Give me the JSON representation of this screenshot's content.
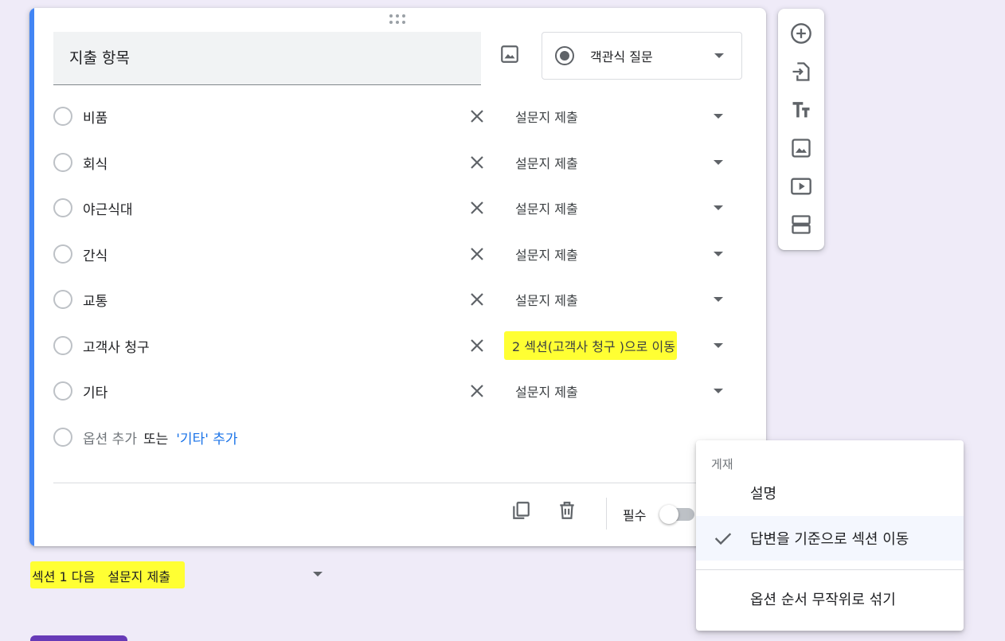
{
  "question": {
    "title": "지출 항목",
    "type_label": "객관식 질문",
    "options": [
      {
        "label": "비품",
        "goto": "설문지 제출",
        "highlight": false
      },
      {
        "label": "회식",
        "goto": "설문지 제출",
        "highlight": false
      },
      {
        "label": "야근식대",
        "goto": "설문지 제출",
        "highlight": false
      },
      {
        "label": "간식",
        "goto": "설문지 제출",
        "highlight": false
      },
      {
        "label": "교통",
        "goto": "설문지 제출",
        "highlight": false
      },
      {
        "label": "고객사 청구",
        "goto": "2 섹션(고객사 청구 )으로 이동",
        "highlight": true
      },
      {
        "label": "기타",
        "goto": "설문지 제출",
        "highlight": false
      }
    ],
    "add_option": {
      "placeholder": "옵션 추가",
      "or": "또는",
      "add_other": "'기타' 추가"
    },
    "required_label": "필수"
  },
  "after_section": {
    "label": "섹션 1 다음",
    "value": "설문지 제출"
  },
  "menu": {
    "heading": "게재",
    "items": [
      {
        "label": "설명",
        "checked": false
      },
      {
        "label": "답변을 기준으로 섹션 이동",
        "checked": true
      },
      {
        "label": "옵션 순서 무작위로 섞기",
        "checked": false
      }
    ]
  },
  "toolbar": {
    "icons": [
      "add-question-icon",
      "import-questions-icon",
      "add-title-icon",
      "add-image-icon",
      "add-video-icon",
      "add-section-icon"
    ]
  },
  "colors": {
    "accent": "#4285f4",
    "highlight": "#ffff33",
    "link": "#1a73e8",
    "background": "#efebf8",
    "brand": "#673ab7"
  }
}
